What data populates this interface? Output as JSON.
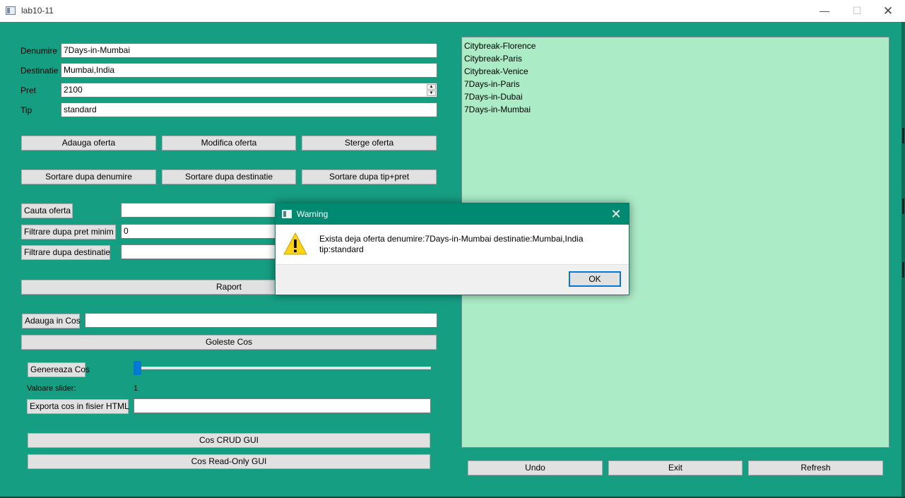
{
  "window": {
    "title": "lab10-11",
    "controls": {
      "minimize": "—",
      "maximize": "☐",
      "close": "✕"
    }
  },
  "form": {
    "denumire_label": "Denumire",
    "denumire_value": "7Days-in-Mumbai",
    "destinatie_label": "Destinatie",
    "destinatie_value": "Mumbai,India",
    "pret_label": "Pret",
    "pret_value": "2100",
    "tip_label": "Tip",
    "tip_value": "standard"
  },
  "buttons": {
    "adauga": "Adauga oferta",
    "modifica": "Modifica oferta",
    "sterge": "Sterge oferta",
    "sort_denumire": "Sortare dupa denumire",
    "sort_destinatie": "Sortare dupa destinatie",
    "sort_tip_pret": "Sortare dupa tip+pret",
    "cauta": "Cauta oferta",
    "filtrare_pret": "Filtrare dupa pret minim",
    "filtrare_destinatie": "Filtrare dupa destinatie",
    "raport": "Raport",
    "adauga_cos": "Adauga in Cos",
    "goleste_cos": "Goleste Cos",
    "genereaza_cos": "Genereaza Cos",
    "exporta_cos": "Exporta cos in fisier HTML",
    "cos_crud": "Cos CRUD GUI",
    "cos_readonly": "Cos Read-Only GUI",
    "undo": "Undo",
    "exit": "Exit",
    "refresh": "Refresh"
  },
  "inputs": {
    "cauta_value": "",
    "filtrare_pret_value": "0",
    "filtrare_destinatie_value": "",
    "adauga_cos_value": "",
    "exporta_value": ""
  },
  "slider": {
    "label": "Valoare slider:",
    "value": "1",
    "fraction": 0
  },
  "list": {
    "items": [
      "Citybreak-Florence",
      "Citybreak-Paris",
      "Citybreak-Venice",
      "7Days-in-Paris",
      "7Days-in-Dubai",
      "7Days-in-Mumbai"
    ]
  },
  "dialog": {
    "title": "Warning",
    "close": "✕",
    "message_line1": "Exista deja oferta denumire:7Days-in-Mumbai destinatie:Mumbai,India",
    "message_line2": "tip:standard",
    "ok": "OK",
    "icon": "warning-icon"
  },
  "colors": {
    "background": "#169e83",
    "list_background": "#abebc6",
    "dialog_titlebar": "#008a72",
    "slider_thumb": "#0078d7",
    "warning": "#fcd116"
  }
}
